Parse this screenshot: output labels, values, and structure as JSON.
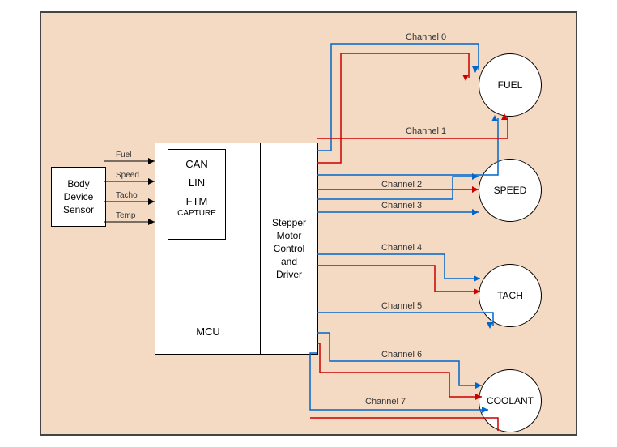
{
  "sensor": {
    "line1": "Body",
    "line2": "Device",
    "line3": "Sensor"
  },
  "signals": [
    "Fuel",
    "Speed",
    "Tacho",
    "Temp"
  ],
  "mcu": {
    "label": "MCU",
    "protocols": [
      "CAN",
      "LIN",
      "FTM"
    ],
    "protocol_sub": "CAPTURE"
  },
  "driver": {
    "l1": "Stepper",
    "l2": "Motor",
    "l3": "Control",
    "l4": "and",
    "l5": "Driver"
  },
  "channels": [
    "Channel 0",
    "Channel 1",
    "Channel 2",
    "Channel 3",
    "Channel 4",
    "Channel 5",
    "Channel 6",
    "Channel 7"
  ],
  "gauges": [
    "FUEL",
    "SPEED",
    "TACH",
    "COOLANT"
  ]
}
